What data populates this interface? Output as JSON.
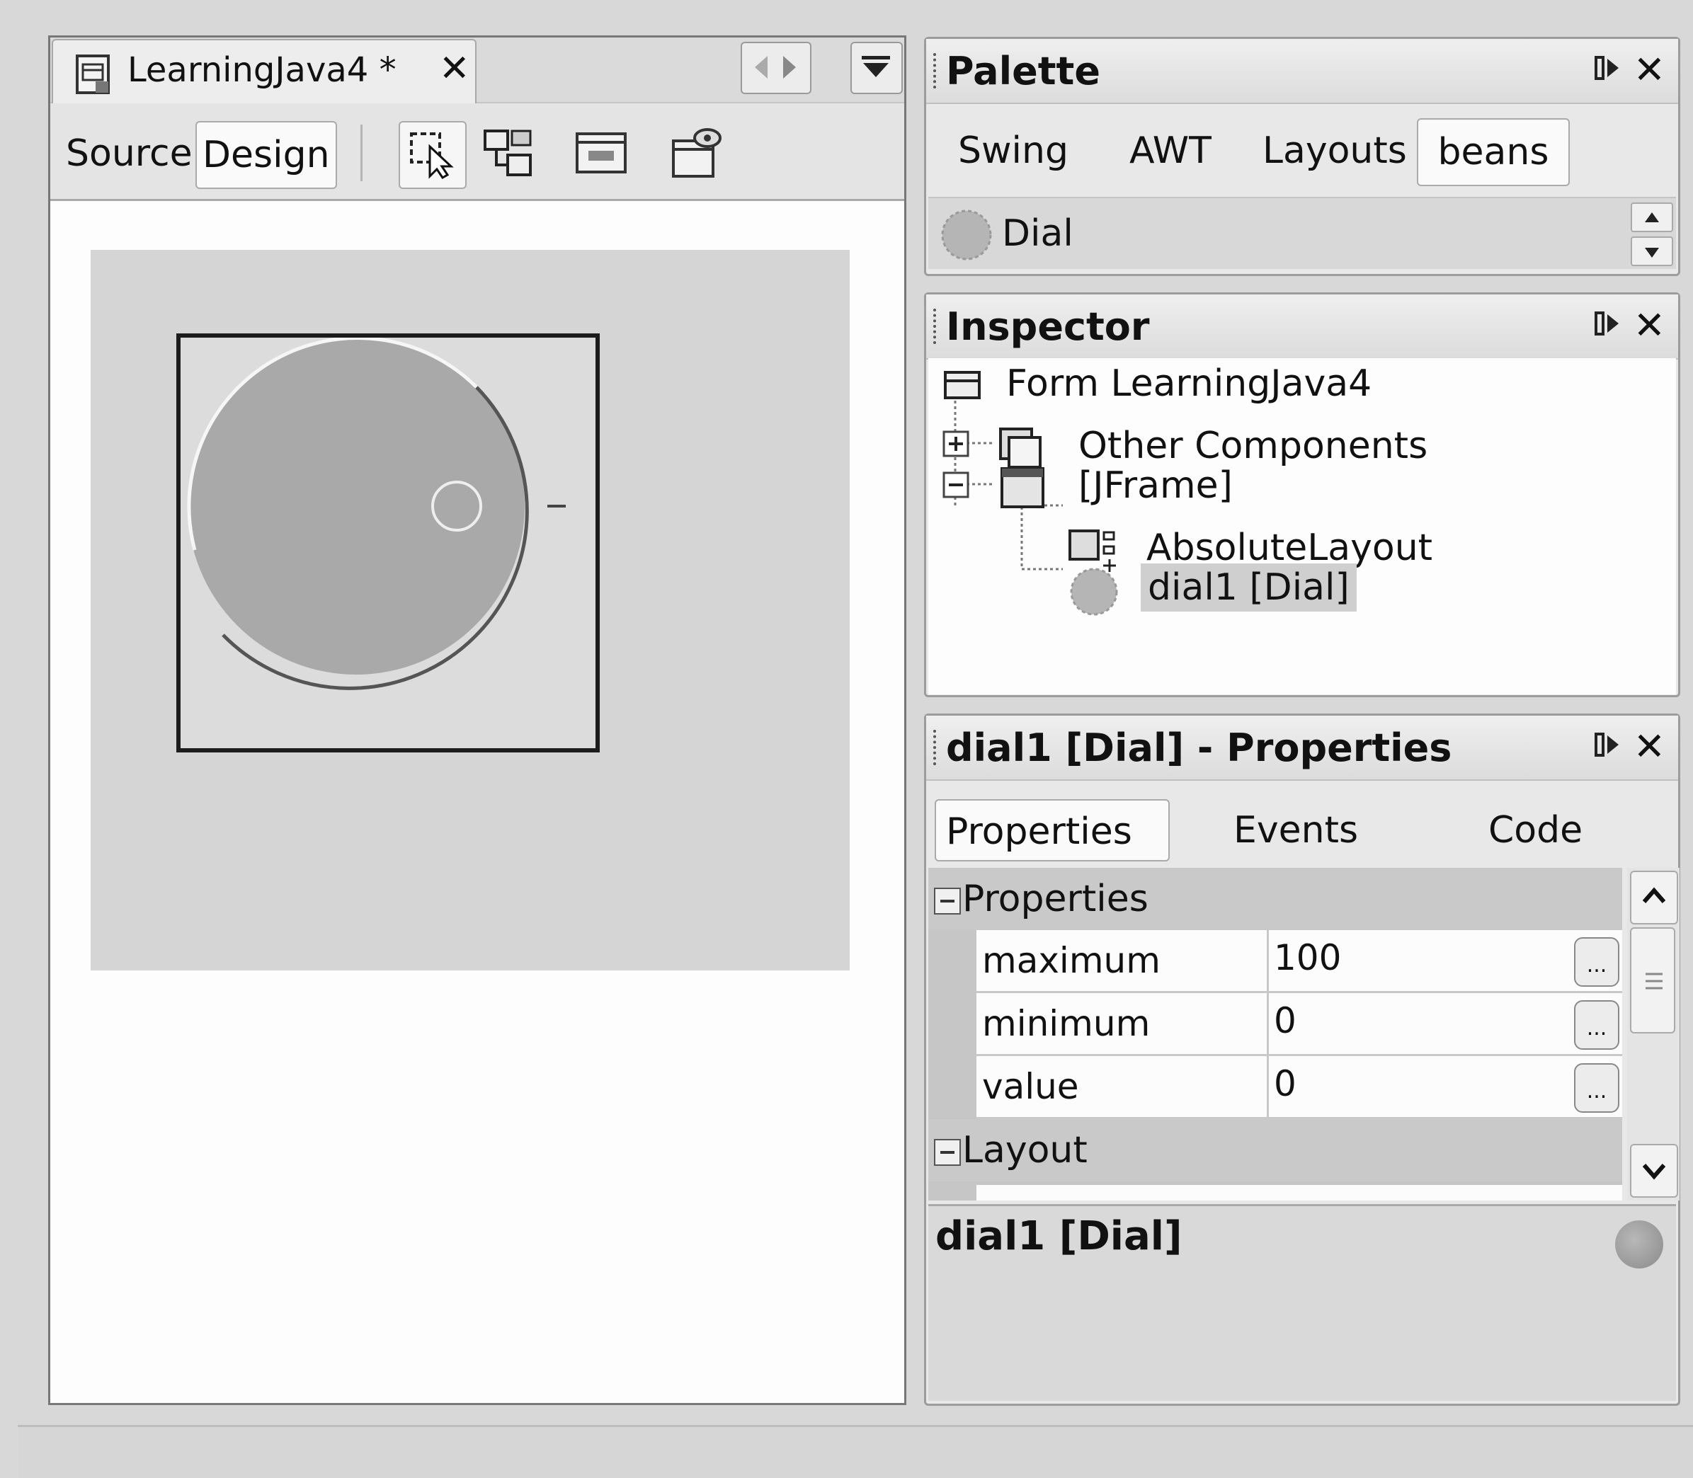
{
  "editor": {
    "tab_title": "LearningJava4 *",
    "tab_close": "✕",
    "views": {
      "source": "Source",
      "design": "Design"
    },
    "toolbar_icons": [
      "selection-mode-icon",
      "connection-mode-icon",
      "preview-design-icon",
      "test-form-icon"
    ]
  },
  "palette": {
    "title": "Palette",
    "tabs": [
      "Swing",
      "AWT",
      "Layouts",
      "beans"
    ],
    "active_tab": "beans",
    "items": [
      {
        "label": "Dial",
        "icon": "dial-bean-icon"
      }
    ]
  },
  "inspector": {
    "title": "Inspector",
    "tree": {
      "root": "Form LearningJava4",
      "other": "Other Components",
      "frame": "[JFrame]",
      "layout": "AbsoluteLayout",
      "dial": "dial1 [Dial]"
    }
  },
  "properties_panel": {
    "title": "dial1 [Dial] - Properties",
    "tabs": [
      "Properties",
      "Events",
      "Code"
    ],
    "active_tab": "Properties",
    "sections": {
      "properties": "Properties",
      "layout": "Layout"
    },
    "rows": [
      {
        "name": "maximum",
        "value": "100"
      },
      {
        "name": "minimum",
        "value": "0"
      },
      {
        "name": "value",
        "value": "0"
      }
    ],
    "ellipsis": "...",
    "description_title": "dial1 [Dial]"
  },
  "window_controls": {
    "close": "✕"
  },
  "colors": {
    "selection": "#cfcfcf",
    "panel": "#e8e8e8",
    "dial": "#a9a9a9"
  }
}
